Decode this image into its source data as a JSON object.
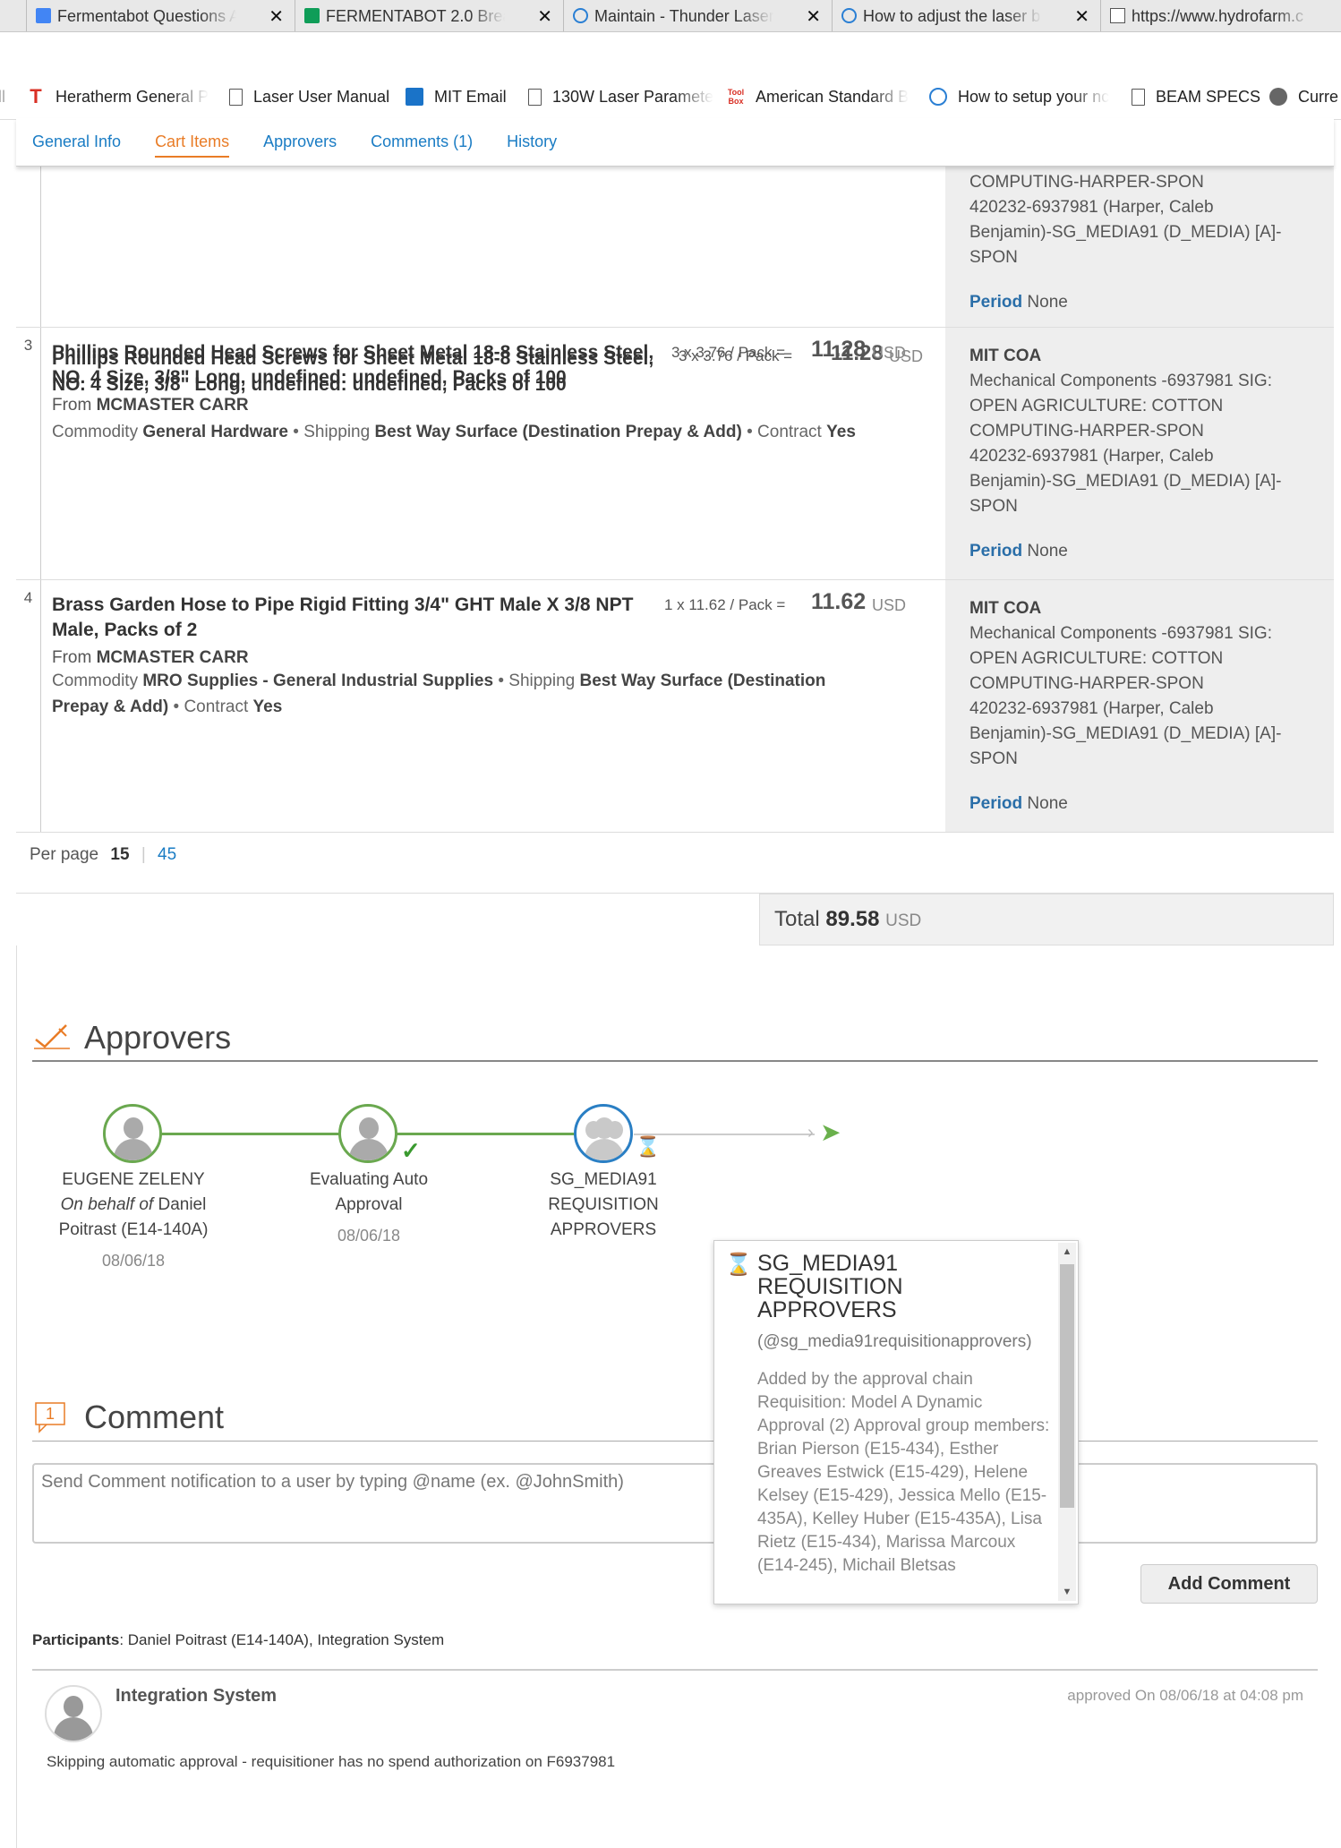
{
  "browser": {
    "tabs": [
      {
        "title": "Fermentabot Questions A",
        "icon": "google-docs-icon"
      },
      {
        "title": "FERMENTABOT 2.0 Breakd",
        "icon": "google-sheets-icon"
      },
      {
        "title": "Maintain - Thunder Laser",
        "icon": "ie-icon"
      },
      {
        "title": "How to adjust the laser b",
        "icon": "ie-icon"
      },
      {
        "title": "https://www.hydrofarm.c",
        "icon": "page-icon"
      }
    ],
    "close_glyph": "✕"
  },
  "bookmarks": [
    {
      "label": "Heratherm General P",
      "icon": "t-icon"
    },
    {
      "label": "Laser User Manual",
      "icon": "page-icon"
    },
    {
      "label": "MIT Email",
      "icon": "outlook-icon"
    },
    {
      "label": "130W Laser Paramete",
      "icon": "page-icon"
    },
    {
      "label": "American Standard B",
      "icon": "toolbox-icon"
    },
    {
      "label": "How to setup your nc",
      "icon": "ie-icon"
    },
    {
      "label": "BEAM SPECS",
      "icon": "page-icon"
    },
    {
      "label": "Curre",
      "icon": "globe-icon"
    }
  ],
  "subnav": {
    "tabs": [
      "General Info",
      "Cart Items",
      "Approvers",
      "Comments (1)",
      "History"
    ],
    "active": "Cart Items"
  },
  "cart": {
    "prev_row_acct": {
      "lines": [
        "COMPUTING-HARPER-SPON",
        "420232-6937981 (Harper, Caleb",
        "Benjamin)-SG_MEDIA91 (D_MEDIA) [A]-",
        "SPON"
      ],
      "period_label": "Period",
      "period_value": "None"
    },
    "rows": [
      {
        "index": "3",
        "title": "Phillips Rounded Head Screws for Sheet Metal 18-8 Stainless Steel, NO. 4 Size, 3/8\" Long, undefined: undefined, Packs of 100",
        "pack": "3 x 3.76 / Pack =",
        "price": "11.28",
        "currency": "USD",
        "from_label": "From",
        "from": "MCMASTER CARR",
        "commodity_label": "Commodity",
        "commodity": "General Hardware",
        "shipping_label": "Shipping",
        "shipping": "Best Way Surface (Destination Prepay & Add)",
        "contract_label": "Contract",
        "contract": "Yes",
        "acct_title": "MIT COA",
        "acct_lines": [
          "Mechanical Components -6937981 SIG:",
          "OPEN AGRICULTURE: COTTON",
          "COMPUTING-HARPER-SPON",
          "420232-6937981 (Harper, Caleb",
          "Benjamin)-SG_MEDIA91 (D_MEDIA) [A]-",
          "SPON"
        ],
        "period_label": "Period",
        "period_value": "None"
      },
      {
        "index": "4",
        "title": "Brass Garden Hose to Pipe Rigid Fitting 3/4\" GHT Male X 3/8 NPT Male, Packs of 2",
        "pack": "1 x 11.62 / Pack =",
        "price": "11.62",
        "currency": "USD",
        "from_label": "From",
        "from": "MCMASTER CARR",
        "commodity_label": "Commodity",
        "commodity": "MRO Supplies - General Industrial Supplies",
        "shipping_label": "Shipping",
        "shipping": "Best Way Surface (Destination Prepay & Add)",
        "contract_label": "Contract",
        "contract": "Yes",
        "acct_title": "MIT COA",
        "acct_lines": [
          "Mechanical Components -6937981 SIG:",
          "OPEN AGRICULTURE: COTTON",
          "COMPUTING-HARPER-SPON",
          "420232-6937981 (Harper, Caleb",
          "Benjamin)-SG_MEDIA91 (D_MEDIA) [A]-",
          "SPON"
        ],
        "period_label": "Period",
        "period_value": "None"
      }
    ],
    "per_page_label": "Per page",
    "per_page_current": "15",
    "per_page_alt": "45",
    "total_label": "Total",
    "total_value": "89.58",
    "total_currency": "USD"
  },
  "approvers": {
    "title": "Approvers",
    "nodes": [
      {
        "name": "EUGENE ZELENY",
        "behalf_prefix": "On behalf of",
        "behalf_rest": "Daniel",
        "behalf_line2": "Poitrast (E14-140A)",
        "date": "08/06/18",
        "status": "done"
      },
      {
        "name_line1": "Evaluating Auto",
        "name_line2": "Approval",
        "date": "08/06/18",
        "status": "approved"
      },
      {
        "name_line1": "SG_MEDIA91",
        "name_line2": "REQUISITION",
        "name_line3": "APPROVERS",
        "status": "pending"
      }
    ],
    "popup": {
      "title": "SG_MEDIA91 REQUISITION APPROVERS",
      "handle": "(@sg_media91requisitionapprovers)",
      "body": "Added by the approval chain Requisition: Model A Dynamic Approval (2) Approval group members: Brian Pierson (E15-434), Esther Greaves Estwick (E15-429), Helene Kelsey (E15-429), Jessica Mello (E15-435A), Kelley Huber (E15-435A), Lisa Rietz (E15-434), Marissa Marcoux (E14-245), Michail Bletsas"
    }
  },
  "comment": {
    "title": "Comment",
    "count": "1",
    "placeholder": "Send Comment notification to a user by typing @name (ex. @JohnSmith)",
    "button": "Add Comment",
    "participants_label": "Participants",
    "participants": ": Daniel Poitrast (E14-140A), Integration System",
    "history": {
      "name": "Integration System",
      "when": "approved On 08/06/18 at 04:08 pm",
      "message": "Skipping automatic approval - requisitioner has no spend authorization on F6937981"
    }
  },
  "colors": {
    "link": "#1a7cc4",
    "active_tab": "#e97c26",
    "approved_green": "#6aa84f",
    "pending_blue": "#2a7fc4"
  }
}
